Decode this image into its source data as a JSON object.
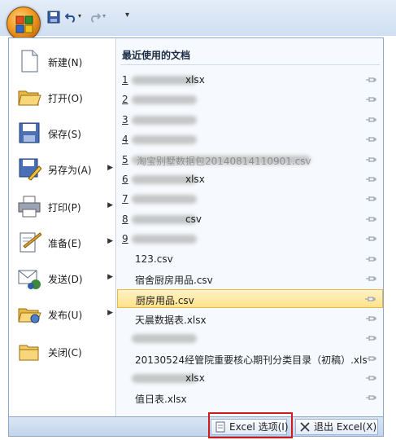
{
  "left_menu": [
    {
      "id": "new",
      "label": "新建(N)",
      "icon": "new-document-icon",
      "arrow": ""
    },
    {
      "id": "open",
      "label": "打开(O)",
      "icon": "open-folder-icon",
      "arrow": ""
    },
    {
      "id": "save",
      "label": "保存(S)",
      "icon": "save-disk-icon",
      "arrow": ""
    },
    {
      "id": "save-as",
      "label": "另存为(A)",
      "icon": "save-as-icon",
      "arrow": "▶"
    },
    {
      "id": "print",
      "label": "打印(P)",
      "icon": "printer-icon",
      "arrow": "▶"
    },
    {
      "id": "prepare",
      "label": "准备(E)",
      "icon": "prepare-icon",
      "arrow": "▶"
    },
    {
      "id": "send",
      "label": "发送(D)",
      "icon": "send-icon",
      "arrow": "▶"
    },
    {
      "id": "publish",
      "label": "发布(U)",
      "icon": "publish-icon",
      "arrow": "▶"
    },
    {
      "id": "close",
      "label": "关闭(C)",
      "icon": "close-folder-icon",
      "arrow": ""
    }
  ],
  "recent": {
    "title": "最近使用的文档",
    "items": [
      {
        "num": "1",
        "name": "xlsx",
        "blur": true,
        "selected": false
      },
      {
        "num": "2",
        "name": "",
        "blur": true,
        "selected": false
      },
      {
        "num": "3",
        "name": "",
        "blur": true,
        "selected": false
      },
      {
        "num": "4",
        "name": "",
        "blur": true,
        "selected": false
      },
      {
        "num": "5",
        "name": "淘宝别墅数据包20140814110901.csv",
        "blur": true,
        "selected": false
      },
      {
        "num": "6",
        "name": "xlsx",
        "blur": true,
        "selected": false
      },
      {
        "num": "7",
        "name": "",
        "blur": true,
        "selected": false
      },
      {
        "num": "8",
        "name": "csv",
        "blur": true,
        "selected": false
      },
      {
        "num": "9",
        "name": "",
        "blur": true,
        "selected": false
      },
      {
        "num": "",
        "name": "123.csv",
        "blur": false,
        "selected": false
      },
      {
        "num": "",
        "name": "宿舍厨房用品.csv",
        "blur": false,
        "selected": false
      },
      {
        "num": "",
        "name": "厨房用品.csv",
        "blur": false,
        "selected": true
      },
      {
        "num": "",
        "name": "天晨数据表.xlsx",
        "blur": false,
        "selected": false
      },
      {
        "num": "",
        "name": "",
        "blur": true,
        "selected": false
      },
      {
        "num": "",
        "name": "20130524经管院重要核心期刊分类目录（初稿）.xls",
        "blur": false,
        "selected": false
      },
      {
        "num": "",
        "name": "xlsx",
        "blur": true,
        "selected": false
      },
      {
        "num": "",
        "name": "值日表.xlsx",
        "blur": false,
        "selected": false
      }
    ]
  },
  "bottom": {
    "options_label": "Excel 选项(I)",
    "exit_label": "退出 Excel(X)"
  }
}
